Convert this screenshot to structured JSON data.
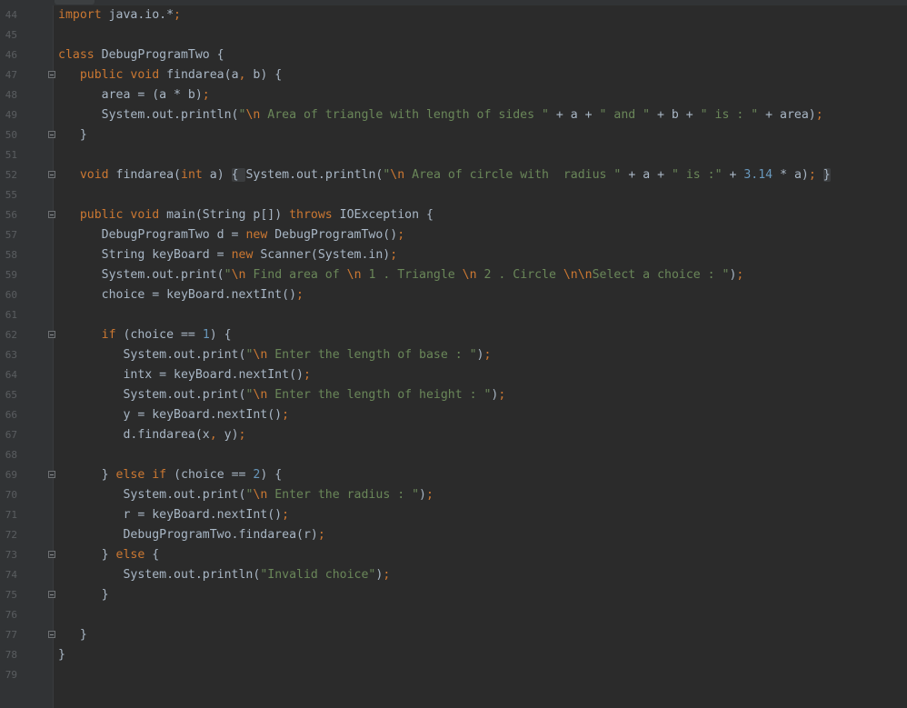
{
  "editor": {
    "lines": [
      {
        "n": "44",
        "fold": false,
        "segs": [
          [
            "kw",
            "import "
          ],
          [
            "pl",
            "java.io.*"
          ],
          [
            "punct",
            ";"
          ]
        ]
      },
      {
        "n": "45",
        "fold": false,
        "segs": []
      },
      {
        "n": "46",
        "fold": false,
        "segs": [
          [
            "kw",
            "class "
          ],
          [
            "pl",
            "DebugProgramTwo {"
          ]
        ]
      },
      {
        "n": "47",
        "fold": true,
        "segs": [
          [
            "pl",
            "   "
          ],
          [
            "kw",
            "public void "
          ],
          [
            "pl",
            "findarea(a"
          ],
          [
            "punct",
            ", "
          ],
          [
            "pl",
            "b) {"
          ]
        ]
      },
      {
        "n": "48",
        "fold": false,
        "segs": [
          [
            "pl",
            "      area = (a * b)"
          ],
          [
            "punct",
            ";"
          ]
        ]
      },
      {
        "n": "49",
        "fold": false,
        "segs": [
          [
            "pl",
            "      System.out.println("
          ],
          [
            "str",
            "\""
          ],
          [
            "esc",
            "\\n"
          ],
          [
            "str",
            " Area of triangle with length of sides \""
          ],
          [
            "pl",
            " + a + "
          ],
          [
            "str",
            "\" and \""
          ],
          [
            "pl",
            " + b + "
          ],
          [
            "str",
            "\" is : \""
          ],
          [
            "pl",
            " + area)"
          ],
          [
            "punct",
            ";"
          ]
        ]
      },
      {
        "n": "50",
        "fold": true,
        "segs": [
          [
            "pl",
            "   }"
          ]
        ]
      },
      {
        "n": "51",
        "fold": false,
        "segs": []
      },
      {
        "n": "52",
        "fold": true,
        "segs": [
          [
            "pl",
            "   "
          ],
          [
            "kw",
            "void "
          ],
          [
            "pl",
            "findarea("
          ],
          [
            "kw",
            "int "
          ],
          [
            "pl",
            "a) "
          ],
          [
            "fb",
            "{ "
          ],
          [
            "pl",
            "System.out.println("
          ],
          [
            "str",
            "\""
          ],
          [
            "esc",
            "\\n"
          ],
          [
            "str",
            " Area of circle with  radius \""
          ],
          [
            "pl",
            " + a + "
          ],
          [
            "str",
            "\" is :\""
          ],
          [
            "pl",
            " + "
          ],
          [
            "num",
            "3.14"
          ],
          [
            "pl",
            " * a)"
          ],
          [
            "punct",
            "; "
          ],
          [
            "fb",
            "}"
          ]
        ]
      },
      {
        "n": "55",
        "fold": false,
        "segs": []
      },
      {
        "n": "56",
        "fold": true,
        "segs": [
          [
            "pl",
            "   "
          ],
          [
            "kw",
            "public void "
          ],
          [
            "pl",
            "main(String p[]) "
          ],
          [
            "kw",
            "throws "
          ],
          [
            "pl",
            "IOException {"
          ]
        ]
      },
      {
        "n": "57",
        "fold": false,
        "segs": [
          [
            "pl",
            "      DebugProgramTwo d = "
          ],
          [
            "kw",
            "new "
          ],
          [
            "pl",
            "DebugProgramTwo()"
          ],
          [
            "punct",
            ";"
          ]
        ]
      },
      {
        "n": "58",
        "fold": false,
        "segs": [
          [
            "pl",
            "      String keyBoard = "
          ],
          [
            "kw",
            "new "
          ],
          [
            "pl",
            "Scanner(System.in)"
          ],
          [
            "punct",
            ";"
          ]
        ]
      },
      {
        "n": "59",
        "fold": false,
        "segs": [
          [
            "pl",
            "      System.out.print("
          ],
          [
            "str",
            "\""
          ],
          [
            "esc",
            "\\n"
          ],
          [
            "str",
            " Find area of "
          ],
          [
            "esc",
            "\\n"
          ],
          [
            "str",
            " 1 . Triangle "
          ],
          [
            "esc",
            "\\n"
          ],
          [
            "str",
            " 2 . Circle "
          ],
          [
            "esc",
            "\\n\\n"
          ],
          [
            "str",
            "Select a choice : \""
          ],
          [
            "pl",
            ")"
          ],
          [
            "punct",
            ";"
          ]
        ]
      },
      {
        "n": "60",
        "fold": false,
        "segs": [
          [
            "pl",
            "      choice = keyBoard.nextInt()"
          ],
          [
            "punct",
            ";"
          ]
        ]
      },
      {
        "n": "61",
        "fold": false,
        "segs": []
      },
      {
        "n": "62",
        "fold": true,
        "segs": [
          [
            "pl",
            "      "
          ],
          [
            "kw",
            "if "
          ],
          [
            "pl",
            "(choice == "
          ],
          [
            "num",
            "1"
          ],
          [
            "pl",
            ") {"
          ]
        ]
      },
      {
        "n": "63",
        "fold": false,
        "segs": [
          [
            "pl",
            "         System.out.print("
          ],
          [
            "str",
            "\""
          ],
          [
            "esc",
            "\\n"
          ],
          [
            "str",
            " Enter the length of base : \""
          ],
          [
            "pl",
            ")"
          ],
          [
            "punct",
            ";"
          ]
        ]
      },
      {
        "n": "64",
        "fold": false,
        "segs": [
          [
            "pl",
            "         intx = keyBoard.nextInt()"
          ],
          [
            "punct",
            ";"
          ]
        ]
      },
      {
        "n": "65",
        "fold": false,
        "segs": [
          [
            "pl",
            "         System.out.print("
          ],
          [
            "str",
            "\""
          ],
          [
            "esc",
            "\\n"
          ],
          [
            "str",
            " Enter the length of height : \""
          ],
          [
            "pl",
            ")"
          ],
          [
            "punct",
            ";"
          ]
        ]
      },
      {
        "n": "66",
        "fold": false,
        "segs": [
          [
            "pl",
            "         y = keyBoard.nextInt()"
          ],
          [
            "punct",
            ";"
          ]
        ]
      },
      {
        "n": "67",
        "fold": false,
        "segs": [
          [
            "pl",
            "         d.findarea(x"
          ],
          [
            "punct",
            ", "
          ],
          [
            "pl",
            "y)"
          ],
          [
            "punct",
            ";"
          ]
        ]
      },
      {
        "n": "68",
        "fold": false,
        "segs": []
      },
      {
        "n": "69",
        "fold": true,
        "segs": [
          [
            "pl",
            "      } "
          ],
          [
            "kw",
            "else if "
          ],
          [
            "pl",
            "(choice == "
          ],
          [
            "num",
            "2"
          ],
          [
            "pl",
            ") {"
          ]
        ]
      },
      {
        "n": "70",
        "fold": false,
        "segs": [
          [
            "pl",
            "         System.out.print("
          ],
          [
            "str",
            "\""
          ],
          [
            "esc",
            "\\n"
          ],
          [
            "str",
            " Enter the radius : \""
          ],
          [
            "pl",
            ")"
          ],
          [
            "punct",
            ";"
          ]
        ]
      },
      {
        "n": "71",
        "fold": false,
        "segs": [
          [
            "pl",
            "         r = keyBoard.nextInt()"
          ],
          [
            "punct",
            ";"
          ]
        ]
      },
      {
        "n": "72",
        "fold": false,
        "segs": [
          [
            "pl",
            "         DebugProgramTwo.findarea(r)"
          ],
          [
            "punct",
            ";"
          ]
        ]
      },
      {
        "n": "73",
        "fold": true,
        "segs": [
          [
            "pl",
            "      } "
          ],
          [
            "kw",
            "else "
          ],
          [
            "pl",
            "{"
          ]
        ]
      },
      {
        "n": "74",
        "fold": false,
        "segs": [
          [
            "pl",
            "         System.out.println("
          ],
          [
            "str",
            "\"Invalid choice\""
          ],
          [
            "pl",
            ")"
          ],
          [
            "punct",
            ";"
          ]
        ]
      },
      {
        "n": "75",
        "fold": true,
        "segs": [
          [
            "pl",
            "      }"
          ]
        ]
      },
      {
        "n": "76",
        "fold": false,
        "segs": []
      },
      {
        "n": "77",
        "fold": true,
        "segs": [
          [
            "pl",
            "   }"
          ]
        ]
      },
      {
        "n": "78",
        "fold": false,
        "segs": [
          [
            "pl",
            "}"
          ]
        ]
      },
      {
        "n": "79",
        "fold": false,
        "segs": []
      }
    ]
  }
}
